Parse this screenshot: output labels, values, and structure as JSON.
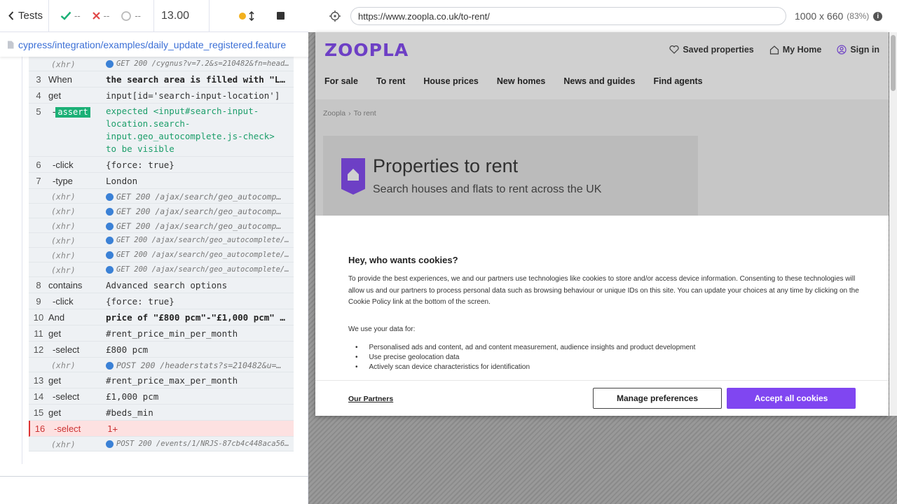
{
  "runner": {
    "tests_label": "Tests",
    "passed": "--",
    "failed": "--",
    "pending": "--",
    "duration": "13.00",
    "spec_path": "cypress/integration/examples/daily_update_registered.feature"
  },
  "commands": [
    {
      "type": "xhr",
      "num": "",
      "name": "(xhr)",
      "msg": "GET 200 /cygnus?v=7.2&s=210482&fn=heade…",
      "small": true
    },
    {
      "type": "std",
      "num": "3",
      "name": "When",
      "msg": "the search area is filled with \"Lon…",
      "bold": true
    },
    {
      "type": "std",
      "num": "4",
      "name": "get",
      "msg": "input[id='search-input-location']"
    },
    {
      "type": "assert",
      "num": "5",
      "name_prefix": "-",
      "badge": "assert",
      "msg": "expected <input#search-input-location.search-input.geo_autocomplete.js-check> to be visible"
    },
    {
      "type": "std",
      "num": "6",
      "name": "-click",
      "msg": "{force: true}",
      "child": true
    },
    {
      "type": "std",
      "num": "7",
      "name": "-type",
      "msg": "London",
      "child": true
    },
    {
      "type": "xhr",
      "num": "",
      "name": "(xhr)",
      "msg": "GET 200 /ajax/search/geo_autocomp…"
    },
    {
      "type": "xhr",
      "num": "",
      "name": "(xhr)",
      "msg": "GET 200 /ajax/search/geo_autocomp…"
    },
    {
      "type": "xhr",
      "num": "",
      "name": "(xhr)",
      "msg": "GET 200 /ajax/search/geo_autocomp…"
    },
    {
      "type": "xhr",
      "num": "",
      "name": "(xhr)",
      "msg": "GET 200 /ajax/search/geo_autocomplete/?…",
      "small": true
    },
    {
      "type": "xhr",
      "num": "",
      "name": "(xhr)",
      "msg": "GET 200 /ajax/search/geo_autocomplete/?…",
      "small": true
    },
    {
      "type": "xhr",
      "num": "",
      "name": "(xhr)",
      "msg": "GET 200 /ajax/search/geo_autocomplete/?…",
      "small": true
    },
    {
      "type": "std",
      "num": "8",
      "name": "contains",
      "msg": "Advanced search options"
    },
    {
      "type": "std",
      "num": "9",
      "name": "-click",
      "msg": "{force: true}",
      "child": true
    },
    {
      "type": "std",
      "num": "10",
      "name": "And",
      "msg": "price of \"£800 pcm\"-\"£1,000 pcm\" fo…",
      "bold": true
    },
    {
      "type": "std",
      "num": "11",
      "name": "get",
      "msg": "#rent_price_min_per_month"
    },
    {
      "type": "std",
      "num": "12",
      "name": "-select",
      "msg": "£800 pcm",
      "child": true
    },
    {
      "type": "xhr",
      "num": "",
      "name": "(xhr)",
      "msg": "POST 200 /headerstats?s=210482&u=…"
    },
    {
      "type": "std",
      "num": "13",
      "name": "get",
      "msg": "#rent_price_max_per_month"
    },
    {
      "type": "std",
      "num": "14",
      "name": "-select",
      "msg": "£1,000 pcm",
      "child": true
    },
    {
      "type": "std",
      "num": "15",
      "name": "get",
      "msg": "#beds_min"
    },
    {
      "type": "std",
      "num": "16",
      "name": "-select",
      "msg": "1+",
      "child": true,
      "error": true
    },
    {
      "type": "xhr",
      "num": "",
      "name": "(xhr)",
      "msg": "POST 200 /events/1/NRJS-87cb4c448aca566…",
      "small": true
    }
  ],
  "preview": {
    "url": "https://www.zoopla.co.uk/to-rent/",
    "viewport_size": "1000 x 660",
    "scale": "(83%)"
  },
  "site": {
    "logo": "ZOOPLA",
    "header_links": [
      "Saved properties",
      "My Home",
      "Sign in"
    ],
    "nav": [
      "For sale",
      "To rent",
      "House prices",
      "New homes",
      "News and guides",
      "Find agents"
    ],
    "breadcrumb": [
      "Zoopla",
      "To rent"
    ],
    "hero_title": "Properties to rent",
    "hero_subtitle": "Search houses and flats to rent across the UK",
    "brand_color": "#8046f1"
  },
  "cookie": {
    "title": "Hey, who wants cookies?",
    "body": "To provide the best experiences, we and our partners use technologies like cookies to store and/or access device information. Consenting to these technologies will allow us and our partners to process personal data such as browsing behaviour or unique IDs on this site. You can update your choices at any time by clicking on the Cookie Policy link at the bottom of the screen.",
    "uses_title": "We use your data for:",
    "uses": [
      "Personalised ads and content, ad and content measurement, audience insights and product development",
      "Use precise geolocation data",
      "Actively scan device characteristics for identification"
    ],
    "partners_link": "Our Partners",
    "manage_label": "Manage preferences",
    "accept_label": "Accept all cookies"
  }
}
